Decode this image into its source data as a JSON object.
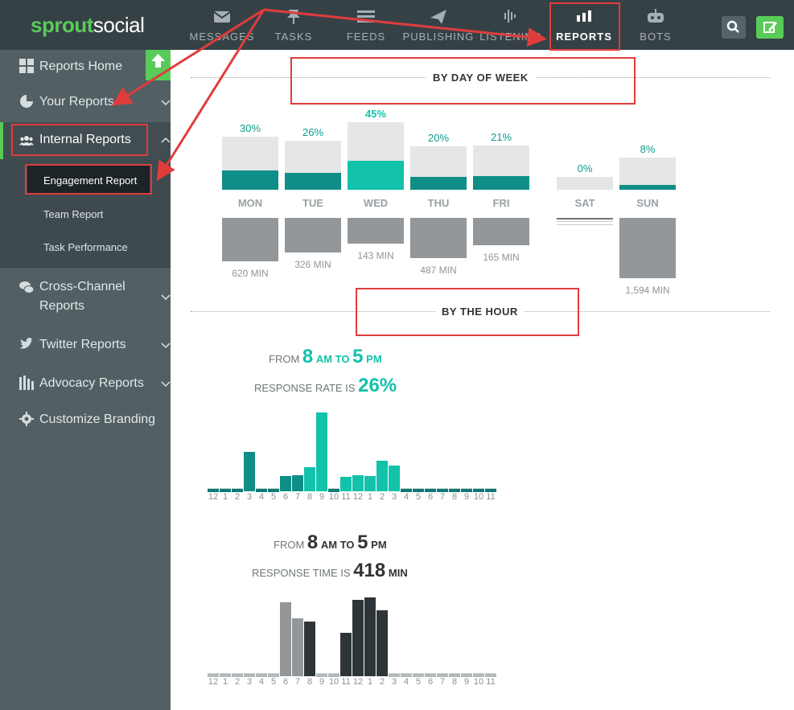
{
  "brand": {
    "part1": "sprout",
    "part2": "social"
  },
  "nav": [
    {
      "label": "MESSAGES",
      "icon": "envelope-icon"
    },
    {
      "label": "TASKS",
      "icon": "pin-icon"
    },
    {
      "label": "FEEDS",
      "icon": "list-icon"
    },
    {
      "label": "PUBLISHING",
      "icon": "paper-plane-icon"
    },
    {
      "label": "LISTENING",
      "icon": "waveform-icon"
    },
    {
      "label": "REPORTS",
      "icon": "bar-chart-icon"
    },
    {
      "label": "BOTS",
      "icon": "robot-icon"
    }
  ],
  "sidebar": {
    "items": [
      {
        "label": "Reports Home",
        "icon": "grid-icon"
      },
      {
        "label": "Your Reports",
        "icon": "pie-chart-icon"
      },
      {
        "label": "Internal Reports",
        "icon": "users-icon"
      },
      {
        "label": "Cross-Channel",
        "label2": "Reports",
        "icon": "chat-bubbles-icon"
      },
      {
        "label": "Twitter Reports",
        "icon": "twitter-icon"
      },
      {
        "label": "Advocacy Reports",
        "icon": "advocacy-icon"
      },
      {
        "label": "Customize Branding",
        "icon": "gear-icon"
      }
    ],
    "sub_items": [
      "Engagement Report",
      "Team Report",
      "Task Performance"
    ]
  },
  "sections": {
    "day_of_week": "BY DAY OF WEEK",
    "by_hour": "BY THE HOUR"
  },
  "days": [
    {
      "day": "MON",
      "rate": "30%",
      "rate_value": 30,
      "mins": "620 MIN",
      "min_value": 620
    },
    {
      "day": "TUE",
      "rate": "26%",
      "rate_value": 26,
      "mins": "326 MIN",
      "min_value": 326
    },
    {
      "day": "WED",
      "rate": "45%",
      "rate_value": 45,
      "mins": "143 MIN",
      "min_value": 143
    },
    {
      "day": "THU",
      "rate": "20%",
      "rate_value": 20,
      "mins": "487 MIN",
      "min_value": 487
    },
    {
      "day": "FRI",
      "rate": "21%",
      "rate_value": 21,
      "mins": "165 MIN",
      "min_value": 165
    },
    {
      "day": "SAT",
      "rate": "0%",
      "rate_value": 0,
      "mins": "",
      "min_value": 0
    },
    {
      "day": "SUN",
      "rate": "8%",
      "rate_value": 8,
      "mins": "1,594 MIN",
      "min_value": 1594
    }
  ],
  "hour_rate": {
    "from": "FROM",
    "start": "8",
    "start_unit": "AM TO",
    "end": "5",
    "end_unit": "PM",
    "label": "RESPONSE RATE IS",
    "value": "26%"
  },
  "hour_time": {
    "from": "FROM",
    "start": "8",
    "start_unit": "AM TO",
    "end": "5",
    "end_unit": "PM",
    "label": "RESPONSE TIME IS",
    "value": "418",
    "unit": "MIN"
  },
  "hour_labels": [
    "12",
    "1",
    "2",
    "3",
    "4",
    "5",
    "6",
    "7",
    "8",
    "9",
    "10",
    "11",
    "12",
    "1",
    "2",
    "3",
    "4",
    "5",
    "6",
    "7",
    "8",
    "9",
    "10",
    "11"
  ],
  "colors": {
    "teal": "#12c2ab",
    "dark_teal": "#0e8e86",
    "brand_green": "#59cb59",
    "annotation_red": "#e03c3c"
  },
  "chart_data": [
    {
      "type": "bar",
      "title": "BY DAY OF WEEK - response rate",
      "categories": [
        "MON",
        "TUE",
        "WED",
        "THU",
        "FRI",
        "SAT",
        "SUN"
      ],
      "values": [
        30,
        26,
        45,
        20,
        21,
        0,
        8
      ],
      "ylabel": "%"
    },
    {
      "type": "bar",
      "title": "BY DAY OF WEEK - response time",
      "categories": [
        "MON",
        "TUE",
        "WED",
        "THU",
        "FRI",
        "SAT",
        "SUN"
      ],
      "values": [
        620,
        326,
        143,
        487,
        165,
        0,
        1594
      ],
      "ylabel": "MIN"
    },
    {
      "type": "bar",
      "title": "BY THE HOUR - response rate",
      "categories": [
        "12",
        "1",
        "2",
        "3",
        "4",
        "5",
        "6",
        "7",
        "8",
        "9",
        "10",
        "11",
        "12",
        "1",
        "2",
        "3",
        "4",
        "5",
        "6",
        "7",
        "8",
        "9",
        "10",
        "11"
      ],
      "values": [
        2,
        2,
        1,
        49,
        2,
        1,
        19,
        20,
        30,
        98,
        2,
        18,
        20,
        19,
        38,
        32,
        2,
        2,
        1,
        1,
        2,
        2,
        1,
        1
      ]
    },
    {
      "type": "bar",
      "title": "BY THE HOUR - response time",
      "categories": [
        "12",
        "1",
        "2",
        "3",
        "4",
        "5",
        "6",
        "7",
        "8",
        "9",
        "10",
        "11",
        "12",
        "1",
        "2",
        "3",
        "4",
        "5",
        "6",
        "7",
        "8",
        "9",
        "10",
        "11"
      ],
      "values": [
        0,
        0,
        0,
        0,
        0,
        0,
        92,
        72,
        68,
        2,
        2,
        54,
        95,
        98,
        82,
        2,
        0,
        0,
        0,
        0,
        0,
        0,
        0,
        0
      ]
    }
  ]
}
